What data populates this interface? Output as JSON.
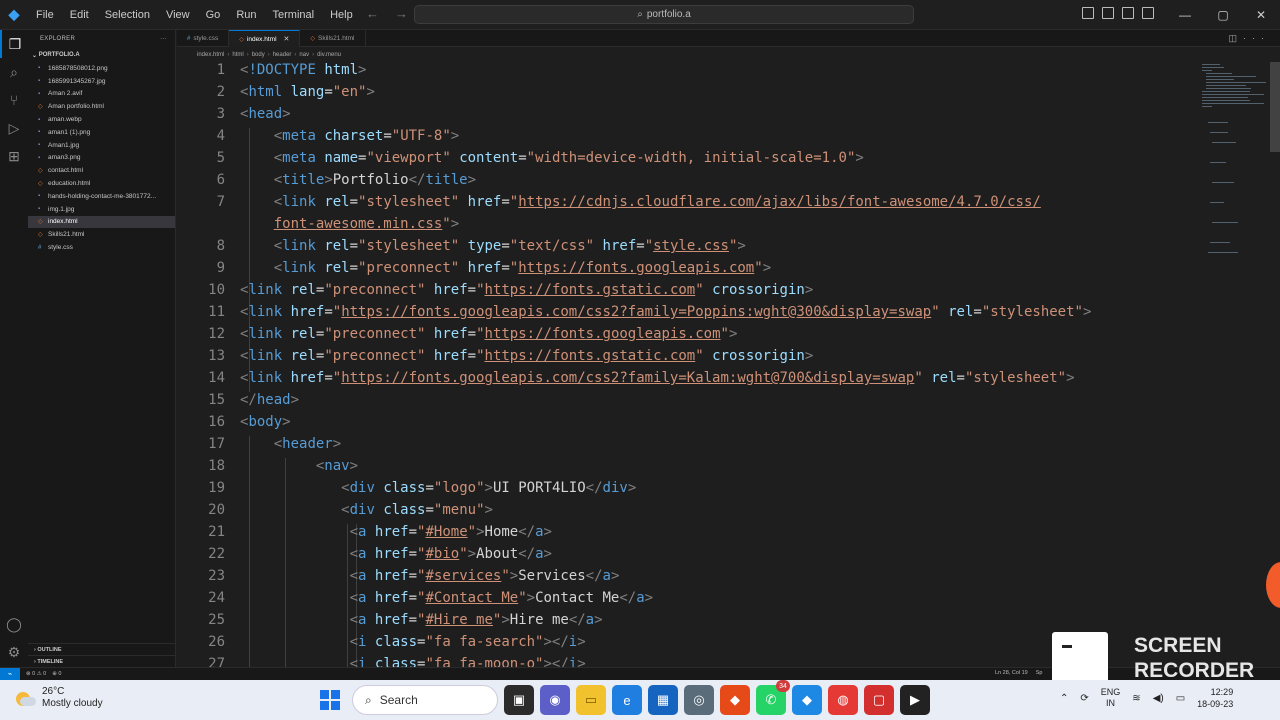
{
  "titlebar": {
    "menus": [
      "File",
      "Edit",
      "Selection",
      "View",
      "Go",
      "Run",
      "Terminal",
      "Help"
    ],
    "search": "portfolio.a"
  },
  "sidebar": {
    "title": "EXPLORER",
    "folder": "PORTFOLIO.A",
    "files": [
      {
        "name": "1685878508012.png",
        "icon": "image-icon"
      },
      {
        "name": "1685991345267.jpg",
        "icon": "image-icon"
      },
      {
        "name": "Aman 2.avif",
        "icon": "image-icon"
      },
      {
        "name": "Aman portfolio.html",
        "icon": "html-icon"
      },
      {
        "name": "aman.webp",
        "icon": "image-icon"
      },
      {
        "name": "aman1 (1).png",
        "icon": "image-icon"
      },
      {
        "name": "Aman1.jpg",
        "icon": "image-icon"
      },
      {
        "name": "aman3.png",
        "icon": "image-icon"
      },
      {
        "name": "contact.html",
        "icon": "html-icon"
      },
      {
        "name": "education.html",
        "icon": "html-icon"
      },
      {
        "name": "hands-holding-contact-me-3801772...",
        "icon": "image-icon"
      },
      {
        "name": "img.1.jpg",
        "icon": "image-icon"
      },
      {
        "name": "index.html",
        "icon": "html-icon",
        "selected": true
      },
      {
        "name": "Skills21.html",
        "icon": "html-icon"
      },
      {
        "name": "style.css",
        "icon": "css-icon"
      }
    ],
    "outline": "OUTLINE",
    "timeline": "TIMELINE"
  },
  "tabs": [
    {
      "label": "style.css",
      "active": false
    },
    {
      "label": "index.html",
      "active": true
    },
    {
      "label": "Skills21.html",
      "active": false
    }
  ],
  "breadcrumb": [
    "index.html",
    "html",
    "body",
    "header",
    "nav",
    "div.menu"
  ],
  "editor": {
    "line_numbers": [
      "1",
      "2",
      "3",
      "4",
      "5",
      "6",
      "7",
      "",
      "8",
      "9",
      "10",
      "11",
      "12",
      "13",
      "14",
      "15",
      "16",
      "17",
      "18",
      "19",
      "20",
      "21",
      "22",
      "23",
      "24",
      "25",
      "26",
      "27"
    ]
  },
  "statusbar": {
    "left": "⊗ 0 ⚠ 0",
    "left2": "⊕ 0",
    "position": "Ln 28, Col 19",
    "spaces": "Sp"
  },
  "taskbar": {
    "temperature": "26°C",
    "weather": "Mostly cloudy",
    "search": "Search",
    "badge": "34",
    "lang1": "ENG",
    "lang2": "IN",
    "time": "12:29",
    "date": "18-09-23"
  },
  "overlay": {
    "recorder_line1": "SCREEN",
    "recorder_line2": "RECORDER"
  }
}
